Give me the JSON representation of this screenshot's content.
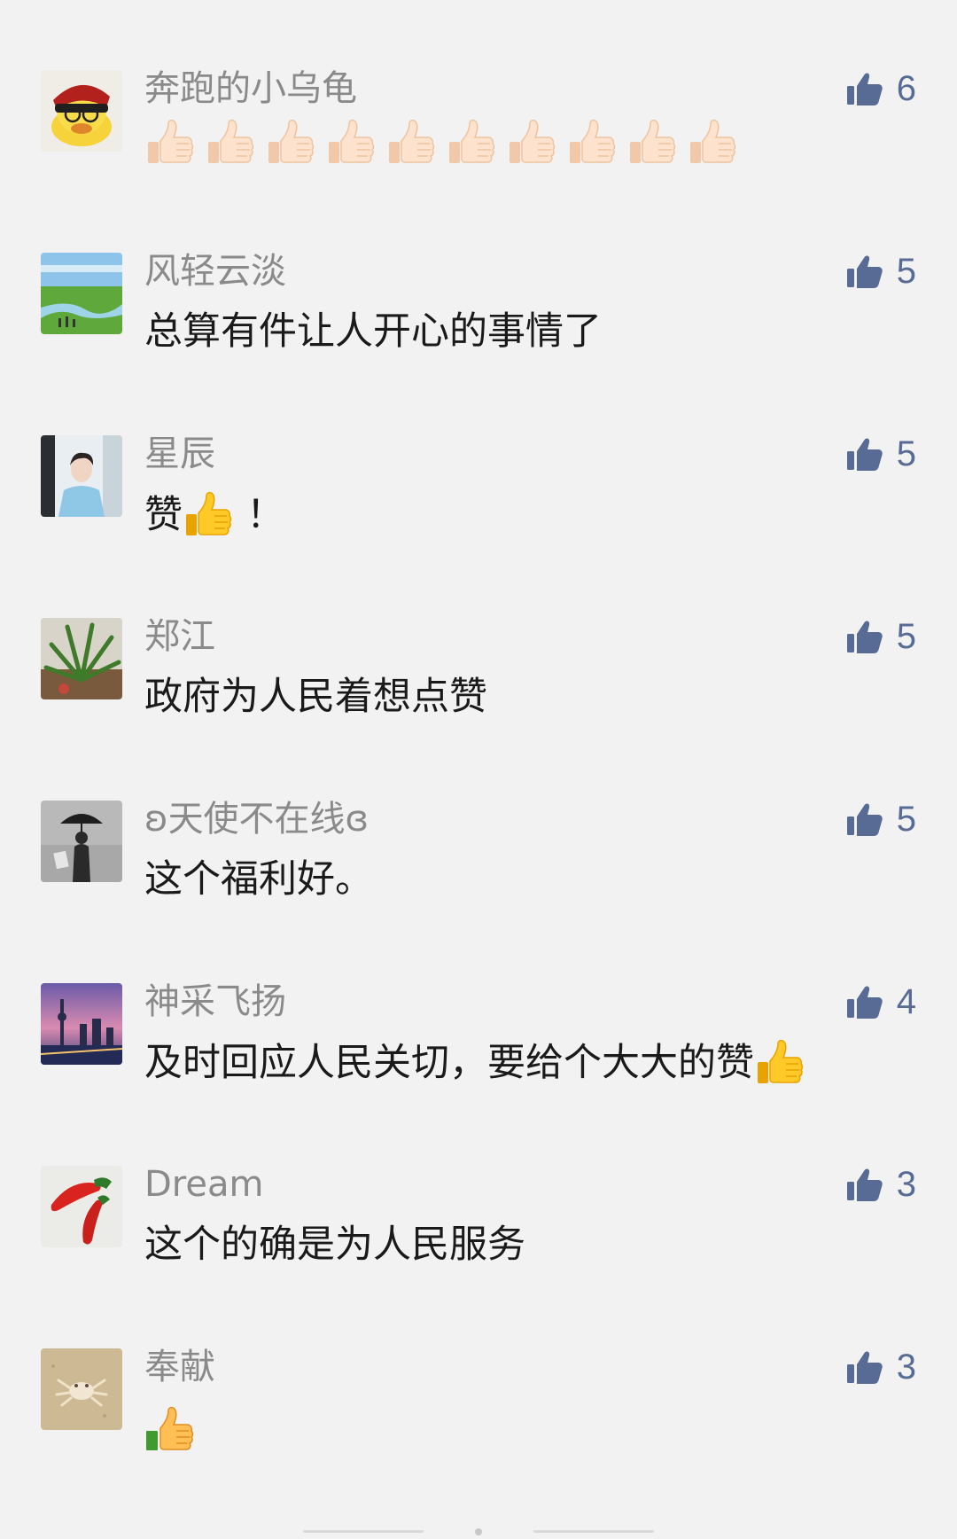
{
  "comments": [
    {
      "nickname": "奔跑的小乌龟",
      "content": "",
      "likes": "6",
      "thumbs": 10,
      "thumb_style": "light"
    },
    {
      "nickname": "风轻云淡",
      "content": "总算有件让人开心的事情了",
      "likes": "5"
    },
    {
      "nickname": "星辰",
      "content_pre": "赞",
      "content_post": "！",
      "likes": "5"
    },
    {
      "nickname": "郑江",
      "content": "政府为人民着想点赞",
      "likes": "5"
    },
    {
      "nickname": "ʚ天使不在线ɞ",
      "content": "这个福利好。",
      "likes": "5"
    },
    {
      "nickname": "神采飞扬",
      "content": "及时回应人民关切，要给个大大的赞",
      "likes": "4"
    },
    {
      "nickname": "Dream",
      "content": "这个的确是为人民服务",
      "likes": "3"
    },
    {
      "nickname": "奉献",
      "content": "",
      "likes": "3"
    }
  ],
  "colors": {
    "background": "#f2f2f2",
    "nickname": "#8a8a8a",
    "content": "#1a1a1a",
    "like_accent": "#576b95"
  },
  "icons": {
    "like": "thumbs-up-icon",
    "emoji_thumb": "thumbs-up-emoji"
  }
}
